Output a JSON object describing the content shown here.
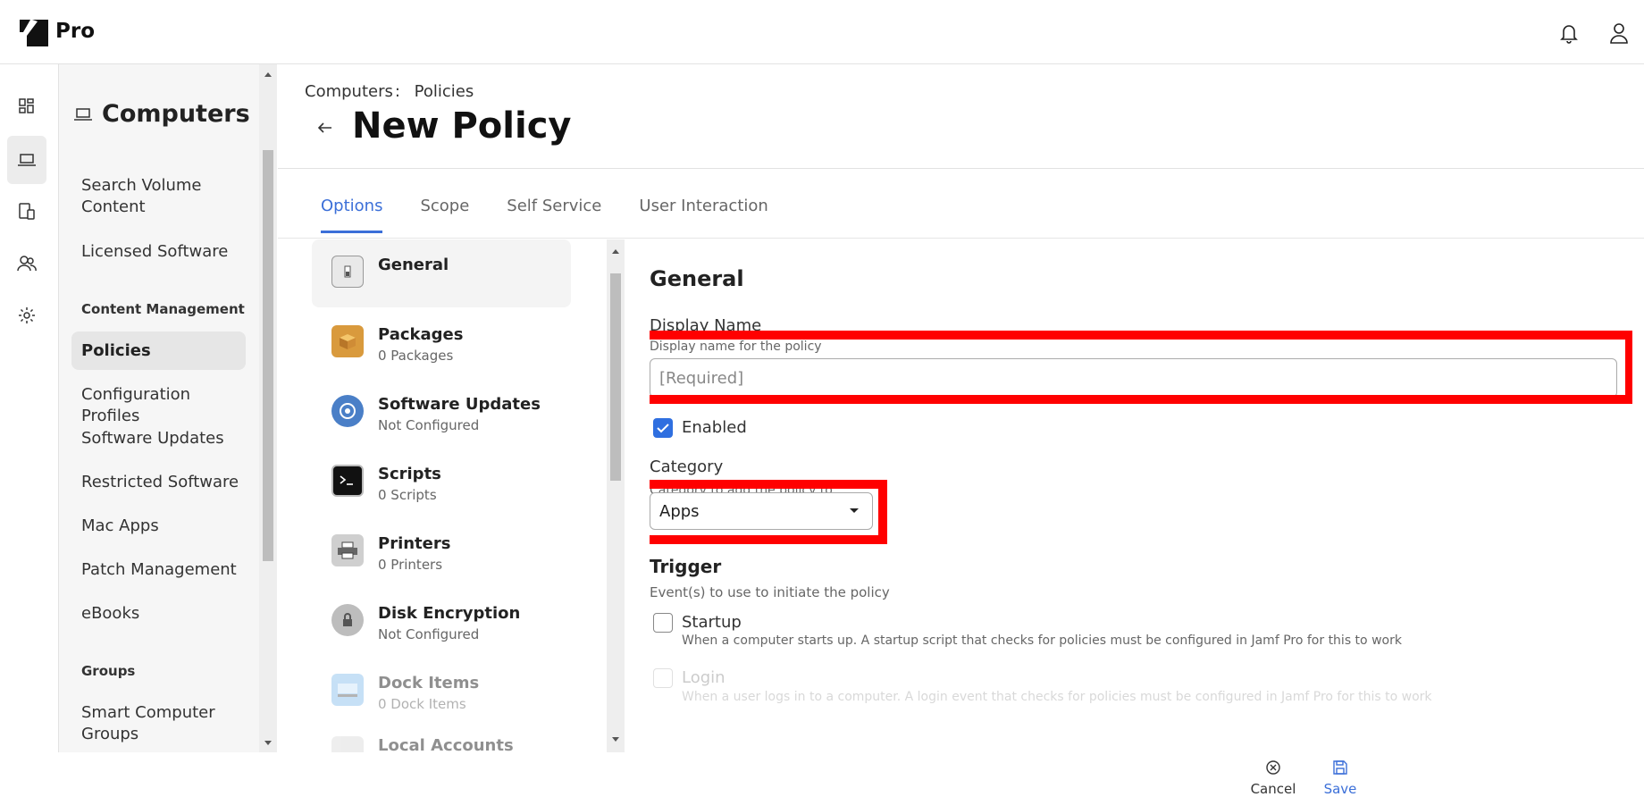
{
  "app": {
    "brand": "Pro"
  },
  "header": {
    "notifications_icon": "bell-icon",
    "account_icon": "user-icon"
  },
  "rail": {
    "items": [
      "dashboard-icon",
      "laptop-icon",
      "devices-icon",
      "users-icon",
      "gear-icon"
    ],
    "active": "laptop-icon"
  },
  "sidebar": {
    "title": "Computers",
    "items_top": [
      "Search Volume Content",
      "Licensed Software"
    ],
    "section_content": "Content Management",
    "items_content": [
      "Policies",
      "Configuration Profiles",
      "Software Updates",
      "Restricted Software",
      "Mac Apps",
      "Patch Management",
      "eBooks"
    ],
    "active_item": "Policies",
    "section_groups": "Groups",
    "items_groups": [
      "Smart Computer Groups"
    ]
  },
  "main": {
    "breadcrumb_root": "Computers",
    "breadcrumb_sep": ":",
    "breadcrumb_current": "Policies",
    "title": "New Policy",
    "tabs": [
      "Options",
      "Scope",
      "Self Service",
      "User Interaction"
    ],
    "active_tab": "Options"
  },
  "options": [
    {
      "name": "General",
      "sub": "",
      "icon": "switch-icon"
    },
    {
      "name": "Packages",
      "sub": "0 Packages",
      "icon": "package-icon"
    },
    {
      "name": "Software Updates",
      "sub": "Not Configured",
      "icon": "software-update-icon"
    },
    {
      "name": "Scripts",
      "sub": "0 Scripts",
      "icon": "terminal-icon"
    },
    {
      "name": "Printers",
      "sub": "0 Printers",
      "icon": "printer-icon"
    },
    {
      "name": "Disk Encryption",
      "sub": "Not Configured",
      "icon": "disk-encryption-icon"
    },
    {
      "name": "Dock Items",
      "sub": "0 Dock Items",
      "icon": "dock-icon"
    },
    {
      "name": "Local Accounts",
      "sub": "",
      "icon": "accounts-icon"
    }
  ],
  "form": {
    "section_title": "General",
    "display_name_label": "Display Name",
    "display_name_help": "Display name for the policy",
    "display_name_placeholder": "[Required]",
    "display_name_value": "",
    "enabled_label": "Enabled",
    "enabled": true,
    "category_label": "Category",
    "category_help": "Category to add the policy to",
    "category_value": "Apps",
    "trigger_title": "Trigger",
    "trigger_help": "Event(s) to use to initiate the policy",
    "startup_label": "Startup",
    "startup_help": "When a computer starts up. A startup script that checks for policies must be configured in Jamf Pro for this to work",
    "login_label": "Login",
    "login_help": "When a user logs in to a computer. A login event that checks for policies must be configured in Jamf Pro for this to work"
  },
  "actions": {
    "cancel": "Cancel",
    "save": "Save"
  },
  "colors": {
    "accent": "#3b6fd8",
    "highlight": "#ff0000",
    "checkbox": "#2f6fe0"
  }
}
